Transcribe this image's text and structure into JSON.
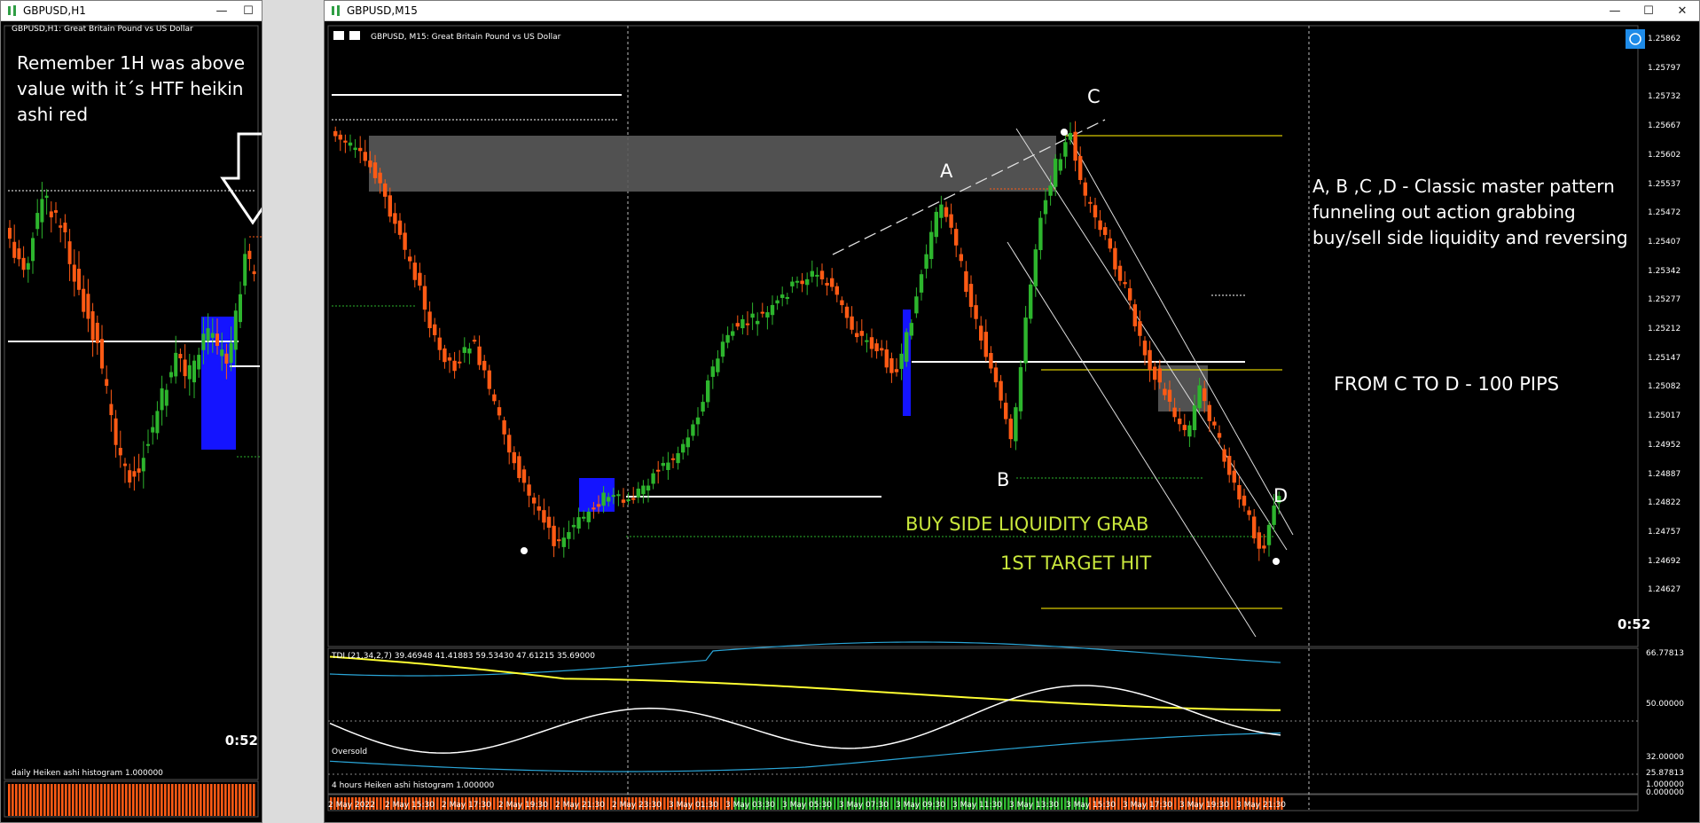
{
  "left_window": {
    "title": "GBPUSD,H1",
    "chart_header": "GBPUSD,H1:  Great Britain Pound vs US Dollar",
    "note": "Remember 1H was above value with it´s HTF heikin ashi red",
    "timer": "0:52",
    "histogram_label": "daily Heiken ashi histogram 1.000000"
  },
  "main_window": {
    "title": "GBPUSD,M15",
    "chart_header": "GBPUSD, M15:  Great Britain Pound vs US Dollar",
    "buttons": {
      "minimize": "—",
      "maximize": "☐",
      "close": "✕"
    },
    "labels": {
      "a": "A",
      "b": "B",
      "c": "C",
      "d": "D"
    },
    "annotation_pattern": "A, B ,C ,D - Classic master pattern funneling out action grabbing buy/sell side liquidity and reversing",
    "annotation_pips": "FROM C TO D - 100 PIPS",
    "annotation_liquidity": "BUY SIDE LIQUIDITY GRAB",
    "annotation_target": "1ST TARGET HIT",
    "timer": "0:52",
    "tdi_label": "TDI (21,34,2,7) 39.46948 41.41883 59.53430 47.61215 35.69000",
    "oversold_label": "Oversold",
    "histogram_label": "4 hours Heiken ashi histogram 1.000000",
    "price_axis": [
      "1.25862",
      "1.25797",
      "1.25732",
      "1.25667",
      "1.25602",
      "1.25537",
      "1.25472",
      "1.25407",
      "1.25342",
      "1.25277",
      "1.25212",
      "1.25147",
      "1.25082",
      "1.25017",
      "1.24952",
      "1.24887",
      "1.24822",
      "1.24757",
      "1.24692",
      "1.24627"
    ],
    "indicator_axis": [
      "66.77813",
      "50.00000",
      "32.00000",
      "25.87813",
      "1.000000",
      "0.000000"
    ],
    "time_axis": [
      "2 May 2022",
      "2 May 15:30",
      "2 May 17:30",
      "2 May 19:30",
      "2 May 21:30",
      "2 May 23:30",
      "3 May 01:30",
      "3 May 03:30",
      "3 May 05:30",
      "3 May 07:30",
      "3 May 09:30",
      "3 May 11:30",
      "3 May 13:30",
      "3 May 15:30",
      "3 May 17:30",
      "3 May 19:30",
      "3 May 21:30"
    ]
  },
  "colors": {
    "bull": "#2db52d",
    "bear": "#ff5a14",
    "zone": "#5a5a5a",
    "accent_text": "#c8e63c",
    "tdi_yellow": "#ffff32",
    "tdi_blue": "#2aa6d8"
  }
}
